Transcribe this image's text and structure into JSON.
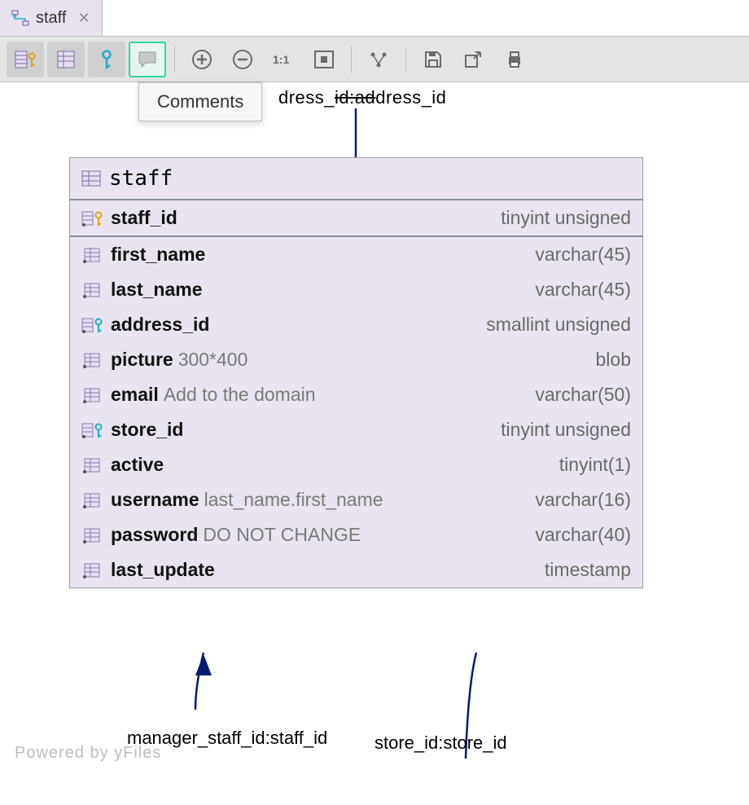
{
  "tab": {
    "label": "staff"
  },
  "tooltip": {
    "text": "Comments"
  },
  "relations": {
    "top": {
      "left_frag": "dress_",
      "strike": "id:ad",
      "right_frag": "dress_id"
    },
    "bottom_left": "manager_staff_id:staff_id",
    "bottom_right": "store_id:store_id"
  },
  "entity": {
    "name": "staff",
    "columns": [
      {
        "name": "staff_id",
        "type": "tinyint unsigned",
        "comment": "",
        "icon": "pk",
        "pk": true
      },
      {
        "name": "first_name",
        "type": "varchar(45)",
        "comment": "",
        "icon": "col",
        "pk": false
      },
      {
        "name": "last_name",
        "type": "varchar(45)",
        "comment": "",
        "icon": "col",
        "pk": false
      },
      {
        "name": "address_id",
        "type": "smallint unsigned",
        "comment": "",
        "icon": "fk",
        "pk": false
      },
      {
        "name": "picture",
        "type": "blob",
        "comment": "300*400",
        "icon": "col",
        "pk": false
      },
      {
        "name": "email",
        "type": "varchar(50)",
        "comment": "Add to the domain",
        "icon": "col",
        "pk": false
      },
      {
        "name": "store_id",
        "type": "tinyint unsigned",
        "comment": "",
        "icon": "fk",
        "pk": false
      },
      {
        "name": "active",
        "type": "tinyint(1)",
        "comment": "",
        "icon": "col",
        "pk": false
      },
      {
        "name": "username",
        "type": "varchar(16)",
        "comment": "last_name.first_name",
        "icon": "col",
        "pk": false
      },
      {
        "name": "password",
        "type": "varchar(40)",
        "comment": "DO NOT CHANGE",
        "icon": "col",
        "pk": false
      },
      {
        "name": "last_update",
        "type": "timestamp",
        "comment": "",
        "icon": "col",
        "pk": false
      }
    ]
  },
  "watermark": "Powered by yFiles"
}
